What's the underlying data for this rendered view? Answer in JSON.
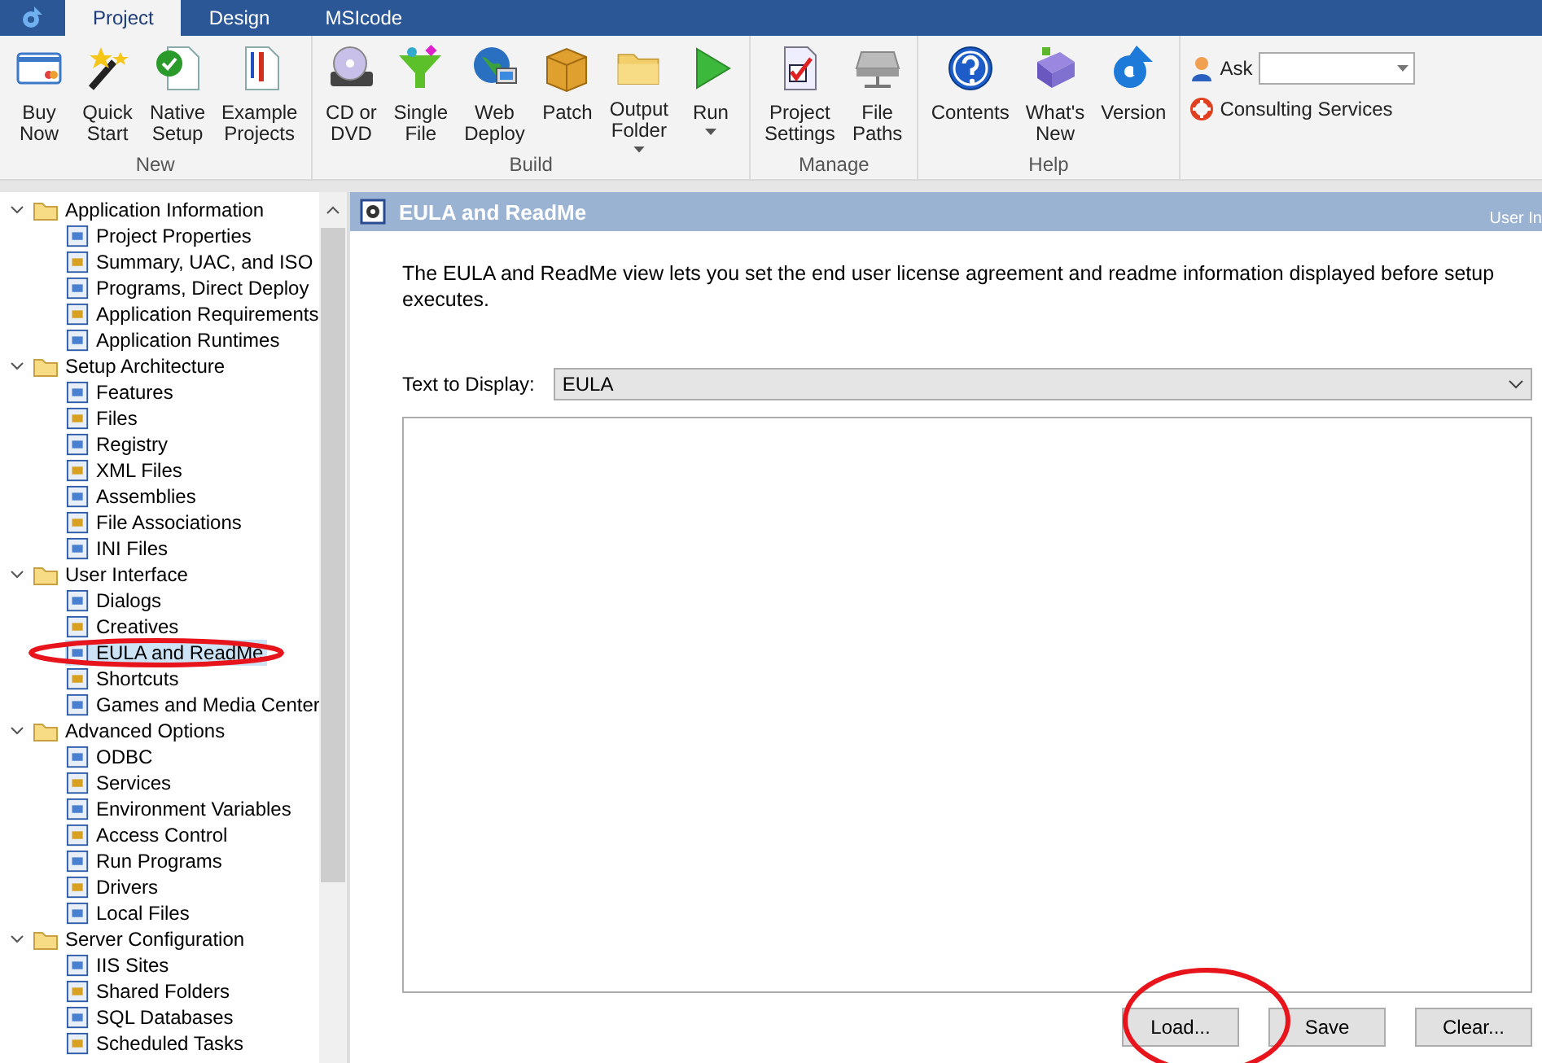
{
  "tabs": [
    {
      "label": "Project",
      "selected": true
    },
    {
      "label": "Design",
      "selected": false
    },
    {
      "label": "MSIcode",
      "selected": false
    }
  ],
  "ribbon": {
    "groups": [
      {
        "label": "New",
        "buttons": [
          {
            "label": "Buy\nNow",
            "dropdown": false
          },
          {
            "label": "Quick\nStart",
            "dropdown": false
          },
          {
            "label": "Native\nSetup",
            "dropdown": false
          },
          {
            "label": "Example\nProjects",
            "dropdown": false
          }
        ]
      },
      {
        "label": "Build",
        "buttons": [
          {
            "label": "CD or\nDVD",
            "dropdown": false
          },
          {
            "label": "Single\nFile",
            "dropdown": false
          },
          {
            "label": "Web\nDeploy",
            "dropdown": false
          },
          {
            "label": "Patch",
            "dropdown": false
          },
          {
            "label": "Output\nFolder",
            "dropdown": true
          },
          {
            "label": "Run",
            "dropdown": true
          }
        ]
      },
      {
        "label": "Manage",
        "buttons": [
          {
            "label": "Project\nSettings",
            "dropdown": false
          },
          {
            "label": "File\nPaths",
            "dropdown": false
          }
        ]
      },
      {
        "label": "Help",
        "buttons": [
          {
            "label": "Contents",
            "dropdown": false
          },
          {
            "label": "What's\nNew",
            "dropdown": false
          },
          {
            "label": "Version",
            "dropdown": false
          }
        ]
      }
    ],
    "ask_label": "Ask",
    "consulting": "Consulting Services"
  },
  "tree": [
    {
      "label": "Application Information",
      "expanded": true,
      "children": [
        {
          "label": "Project Properties",
          "selected": false
        },
        {
          "label": "Summary, UAC, and ISO",
          "selected": false
        },
        {
          "label": "Programs, Direct Deploy",
          "selected": false
        },
        {
          "label": "Application Requirements",
          "selected": false
        },
        {
          "label": "Application Runtimes",
          "selected": false
        }
      ]
    },
    {
      "label": "Setup Architecture",
      "expanded": true,
      "children": [
        {
          "label": "Features",
          "selected": false
        },
        {
          "label": "Files",
          "selected": false
        },
        {
          "label": "Registry",
          "selected": false
        },
        {
          "label": "XML Files",
          "selected": false
        },
        {
          "label": "Assemblies",
          "selected": false
        },
        {
          "label": "File Associations",
          "selected": false
        },
        {
          "label": "INI Files",
          "selected": false
        }
      ]
    },
    {
      "label": "User Interface",
      "expanded": true,
      "children": [
        {
          "label": "Dialogs",
          "selected": false
        },
        {
          "label": "Creatives",
          "selected": false
        },
        {
          "label": "EULA and ReadMe",
          "selected": true
        },
        {
          "label": "Shortcuts",
          "selected": false
        },
        {
          "label": "Games and Media Center",
          "selected": false
        }
      ]
    },
    {
      "label": "Advanced Options",
      "expanded": true,
      "children": [
        {
          "label": "ODBC",
          "selected": false
        },
        {
          "label": "Services",
          "selected": false
        },
        {
          "label": "Environment Variables",
          "selected": false
        },
        {
          "label": "Access Control",
          "selected": false
        },
        {
          "label": "Run Programs",
          "selected": false
        },
        {
          "label": "Drivers",
          "selected": false
        },
        {
          "label": "Local Files",
          "selected": false
        }
      ]
    },
    {
      "label": "Server Configuration",
      "expanded": true,
      "children": [
        {
          "label": "IIS Sites",
          "selected": false
        },
        {
          "label": "Shared Folders",
          "selected": false
        },
        {
          "label": "SQL Databases",
          "selected": false
        },
        {
          "label": "Scheduled Tasks",
          "selected": false
        }
      ]
    }
  ],
  "view": {
    "title": "EULA and ReadMe",
    "breadcrumb": "User In",
    "description": "The EULA and ReadMe view lets you set the end user license agreement and readme information displayed before setup executes.",
    "field_label": "Text to Display:",
    "field_value": "EULA",
    "buttons": [
      "Load...",
      "Save",
      "Clear..."
    ]
  }
}
